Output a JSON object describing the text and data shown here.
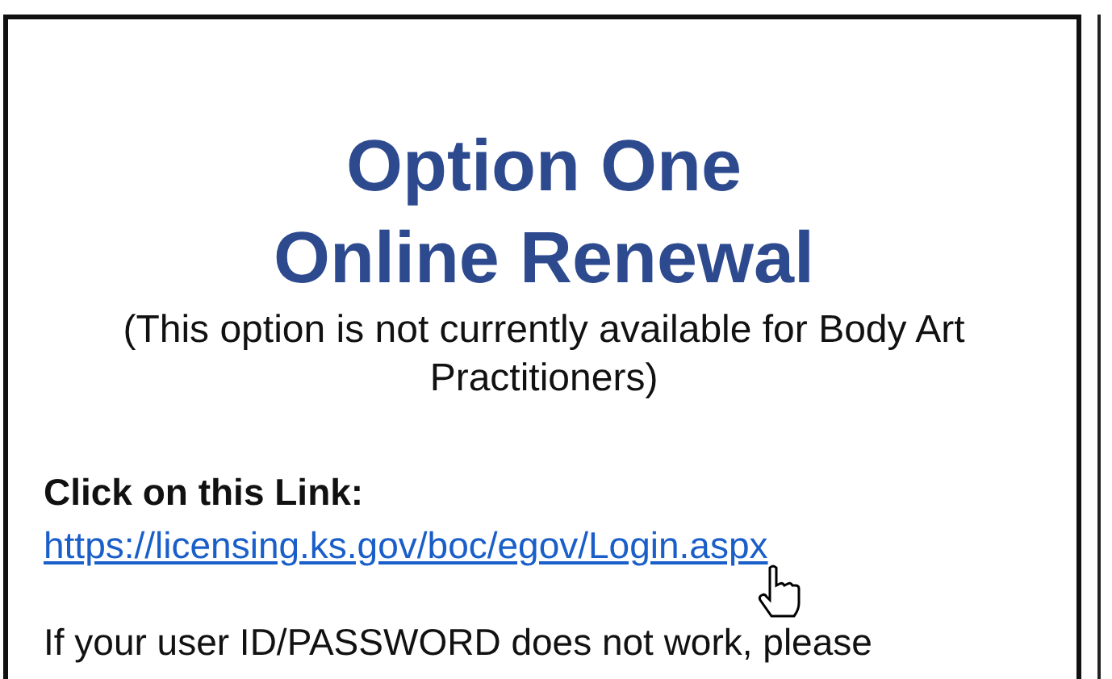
{
  "heading": [
    "Option One",
    "Online Renewal"
  ],
  "note": "(This option is not currently available for Body Art Practitioners)",
  "link_label": "Click on this Link:",
  "link": "https://licensing.ks.gov/boc/egov/Login.aspx",
  "paragraph": "If your user ID/PASSWORD does not work, please"
}
